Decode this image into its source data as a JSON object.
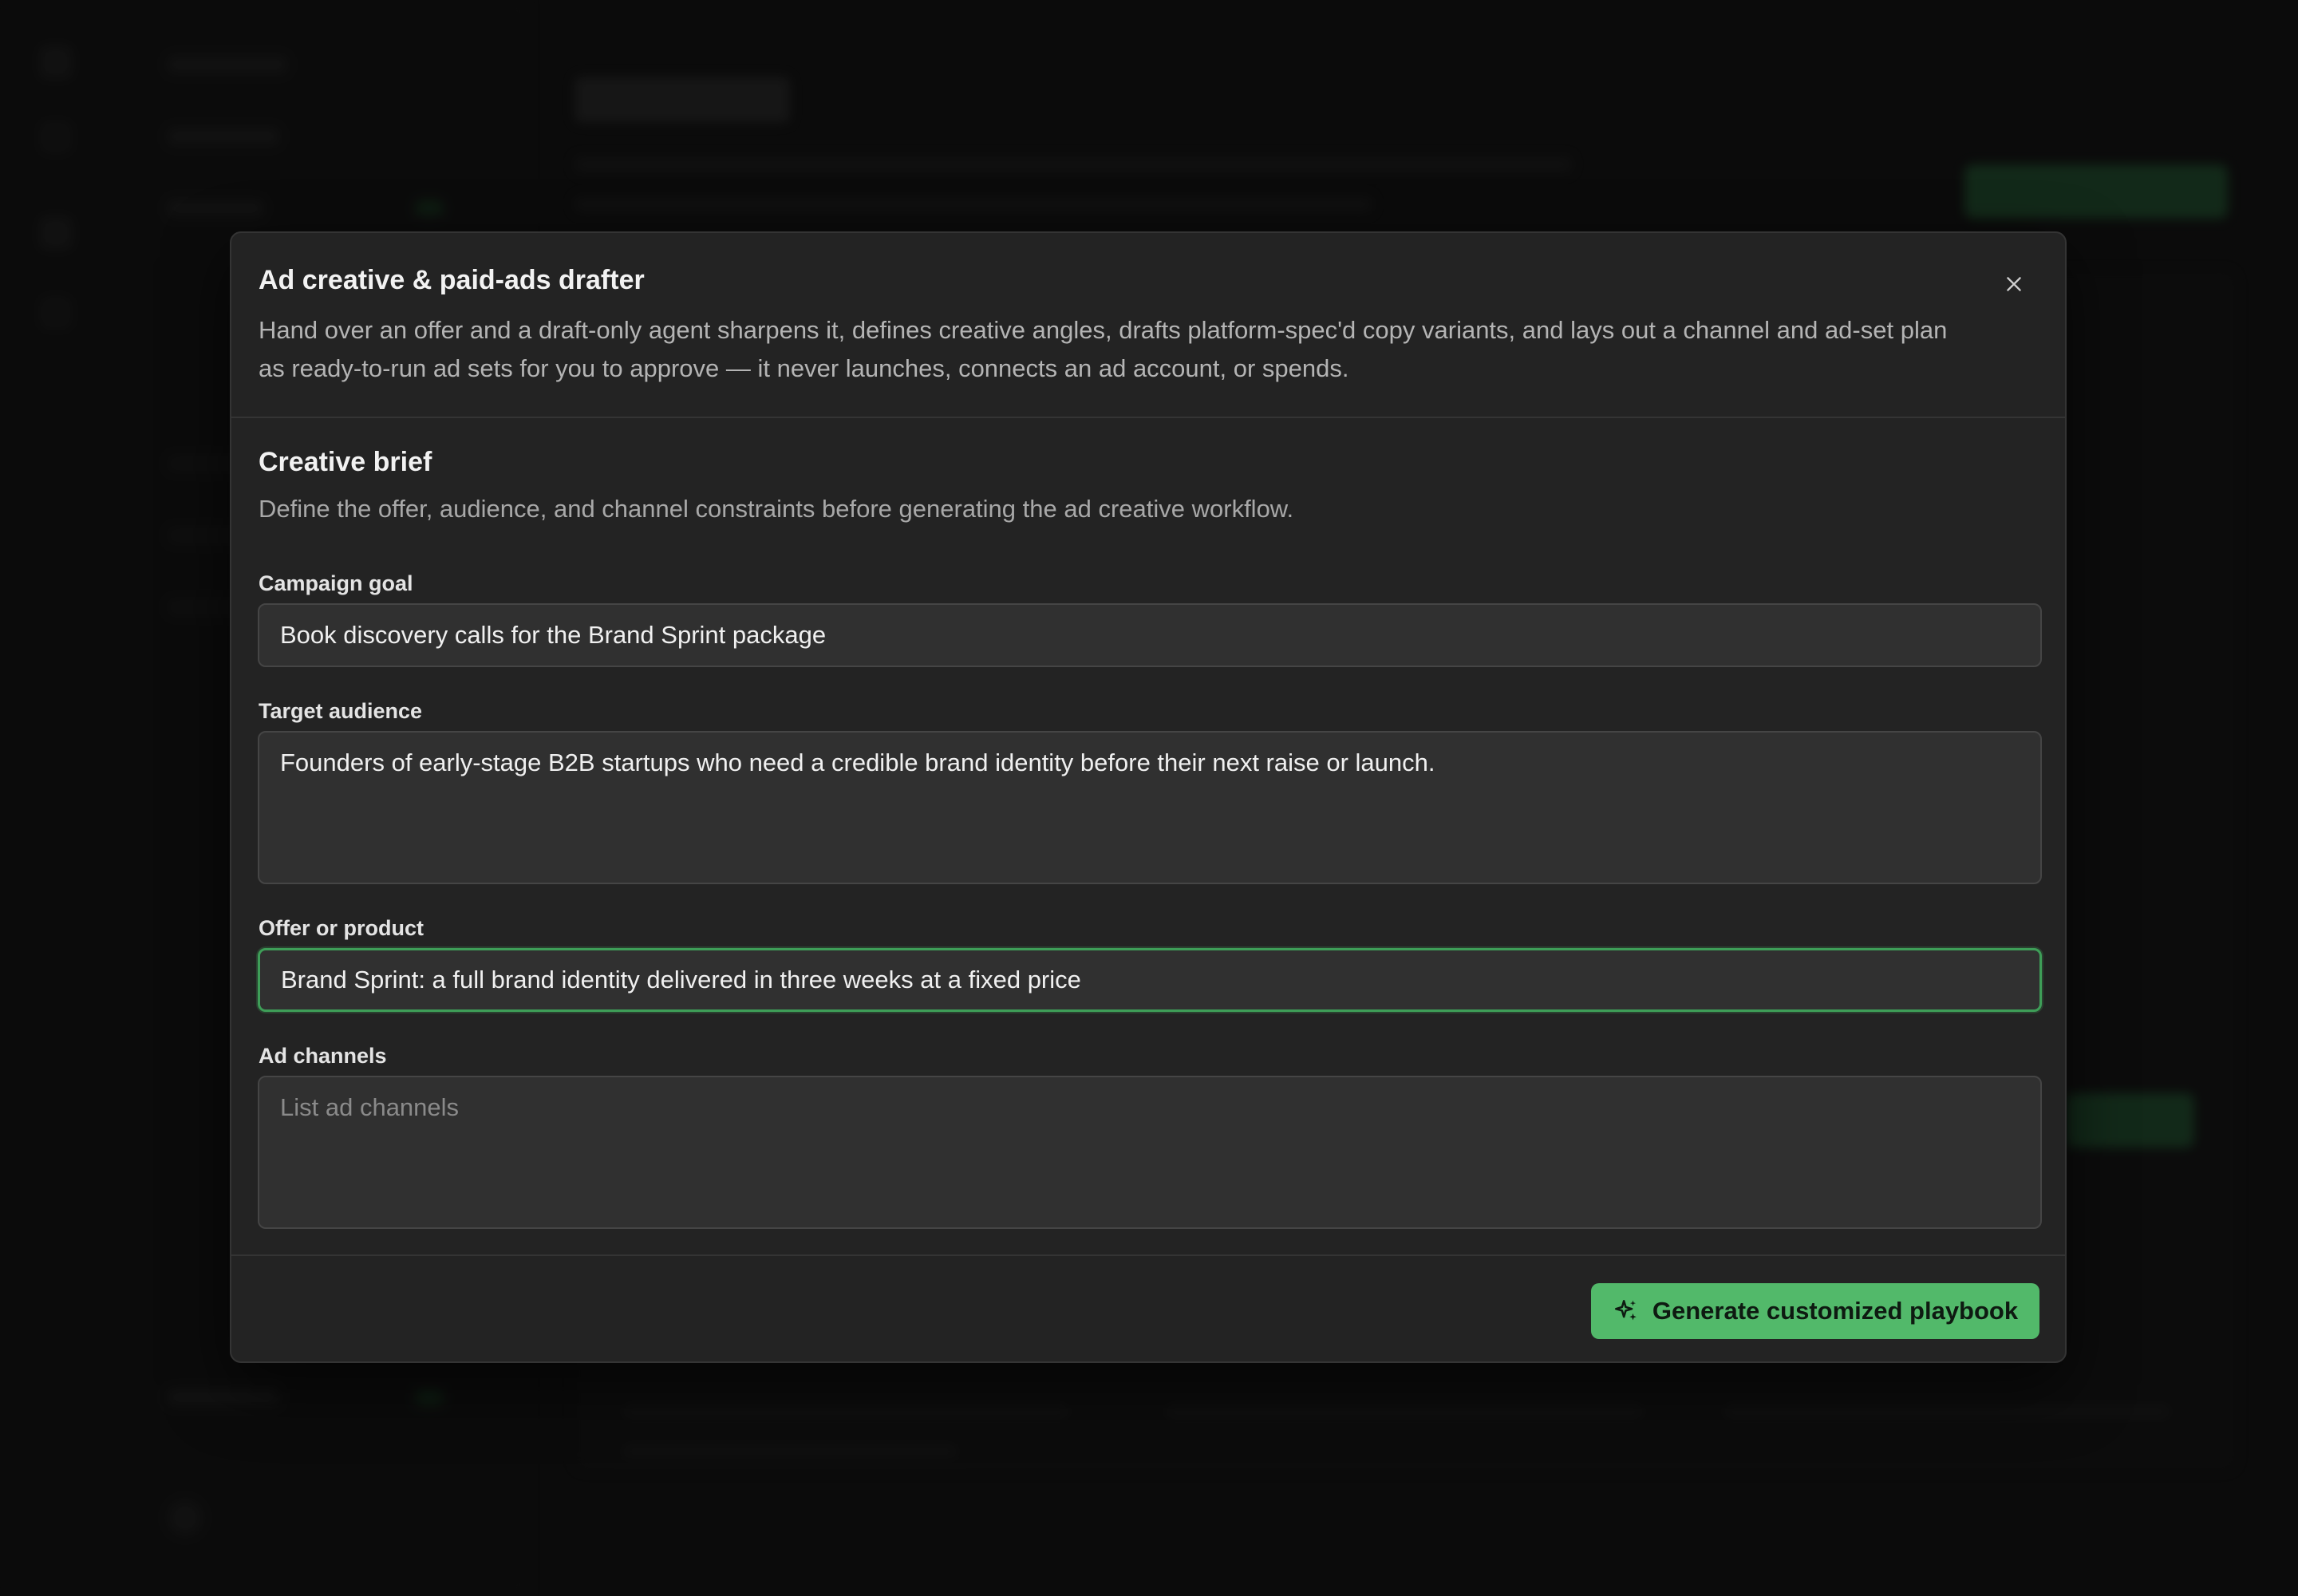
{
  "modal": {
    "title": "Ad creative & paid-ads drafter",
    "description": "Hand over an offer and a draft-only agent sharpens it, defines creative angles, drafts platform-spec'd copy variants, and lays out a channel and ad-set plan as ready-to-run ad sets for you to approve — it never launches, connects an ad account, or spends.",
    "close_icon": "close-icon"
  },
  "brief": {
    "title": "Creative brief",
    "description": "Define the offer, audience, and channel constraints before generating the ad creative workflow."
  },
  "fields": {
    "campaign_goal": {
      "label": "Campaign goal",
      "value": "Book discovery calls for the Brand Sprint package"
    },
    "target_audience": {
      "label": "Target audience",
      "value": "Founders of early-stage B2B startups who need a credible brand identity before their next raise or launch."
    },
    "offer": {
      "label": "Offer or product",
      "value": "Brand Sprint: a full brand identity delivered in three weeks at a fixed price"
    },
    "ad_channels": {
      "label": "Ad channels",
      "value": "",
      "placeholder": "List ad channels"
    }
  },
  "footer": {
    "generate_label": "Generate customized playbook",
    "generate_icon": "sparkles-icon"
  },
  "colors": {
    "accent": "#52b96a",
    "focus_border": "#3e9e58",
    "modal_bg": "#232323",
    "input_bg": "#303030"
  }
}
